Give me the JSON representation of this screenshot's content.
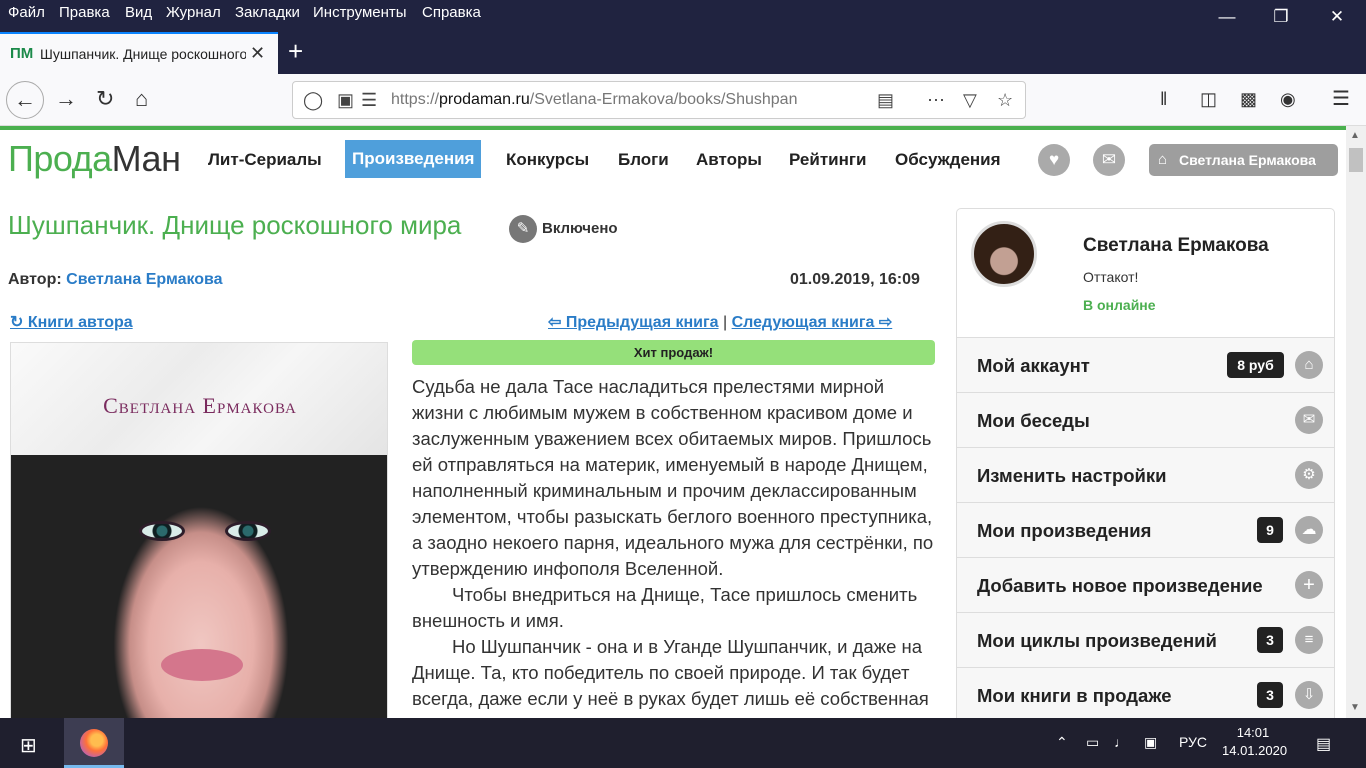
{
  "menubar": {
    "items": [
      "Файл",
      "Правка",
      "Вид",
      "Журнал",
      "Закладки",
      "Инструменты",
      "Справка"
    ]
  },
  "window_controls": {
    "minimize": "—",
    "maximize": "❐",
    "close": "✕"
  },
  "tab": {
    "favicon": "ПМ",
    "title": "Шушпанчик. Днище роскошного мира",
    "close": "✕",
    "new_tab": "+"
  },
  "browser": {
    "url": "https://prodaman.ru/Svetlana-Ermakova/books/Shushpanchik-Dnische-roskoshnogo-mira",
    "url_display_host": "prodaman.ru",
    "url_prefix": "https://",
    "url_path": "/Svetlana-Ermakova/books/Shushpan"
  },
  "site": {
    "logo_a": "Прода",
    "logo_b": "Ман",
    "nav": [
      "Лит-Сериалы",
      "Произведения",
      "Конкурсы",
      "Блоги",
      "Авторы",
      "Рейтинги",
      "Обсуждения"
    ],
    "user_button": "Светлана Ермакова"
  },
  "book": {
    "title": "Шушпанчик. Днище роскошного мира",
    "status": "Включено",
    "author_label": "Автор:",
    "author": "Светлана Ермакова",
    "date": "01.09.2019, 16:09",
    "author_books": "↻ Книги автора",
    "prev": "⇦ Предыдущая книга",
    "sep": "|",
    "next": "Следующая книга ⇨",
    "cover_author": "Светлана Ермакова",
    "hit": "Хит продаж!",
    "paragraphs": [
      "Судьба не дала Тасе насладиться прелестями мирной жизни с любимым мужем в собственном красивом доме и заслуженным уважением всех обитаемых миров. Пришлось ей отправляться на материк, именуемый в народе Днищем, наполненный криминальным и прочим деклассированным элементом, чтобы разыскать беглого военного преступника, а заодно некоего парня, идеального мужа для сестрёнки, по утверждению инфополя Вселенной.",
      "Чтобы внедриться на Днище, Тасе пришлось сменить внешность и имя.",
      "Но Шушпанчик - она и в Уганде Шушпанчик, и даже на Днище. Та, кто победитель по своей природе. И так будет всегда, даже если у неё в руках будет лишь её собственная жизнь."
    ]
  },
  "sidebar": {
    "name": "Светлана Ермакова",
    "status": "Оттакот!",
    "online": "В онлайне",
    "items": [
      {
        "label": "Мой аккаунт",
        "badge": "8 руб",
        "icon": "⌂"
      },
      {
        "label": "Мои беседы",
        "badge": "",
        "icon": "✉"
      },
      {
        "label": "Изменить настройки",
        "badge": "",
        "icon": "⚙"
      },
      {
        "label": "Мои произведения",
        "badge": "9",
        "icon": "☁"
      },
      {
        "label": "Добавить новое произведение",
        "badge": "",
        "icon": "+"
      },
      {
        "label": "Мои циклы произведений",
        "badge": "3",
        "icon": "≡"
      },
      {
        "label": "Мои книги в продаже",
        "badge": "3",
        "icon": "⇩"
      }
    ]
  },
  "taskbar": {
    "lang": "РУС",
    "time": "14:01",
    "date": "14.01.2020"
  }
}
